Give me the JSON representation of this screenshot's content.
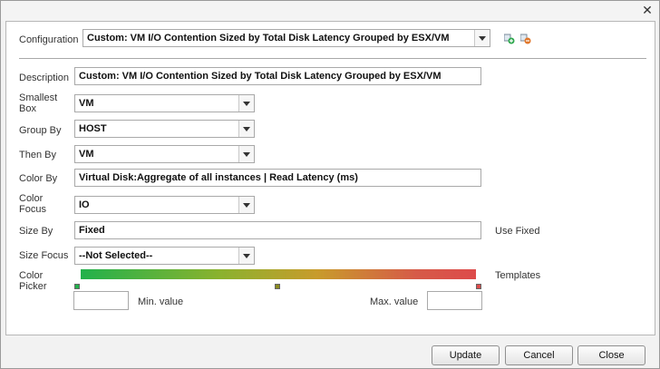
{
  "header": {
    "configuration_label": "Configuration",
    "configuration_value": "Custom: VM I/O Contention Sized by Total Disk Latency Grouped by ESX/VM"
  },
  "form": {
    "description_label": "Description",
    "description_value": "Custom: VM I/O Contention Sized by Total Disk Latency Grouped by ESX/VM",
    "smallest_box_label": "Smallest Box",
    "smallest_box_value": "VM",
    "group_by_label": "Group By",
    "group_by_value": "HOST",
    "then_by_label": "Then By",
    "then_by_value": "VM",
    "color_by_label": "Color By",
    "color_by_value": "Virtual Disk:Aggregate of all instances | Read Latency (ms)",
    "color_focus_label": "Color Focus",
    "color_focus_value": "IO",
    "size_by_label": "Size By",
    "size_by_value": "Fixed",
    "use_fixed_label": "Use Fixed",
    "size_focus_label": "Size Focus",
    "size_focus_value": "--Not Selected--",
    "color_picker_label": "Color Picker",
    "templates_label": "Templates",
    "min_value_label": "Min. value",
    "max_value_label": "Max. value",
    "min_value": "",
    "max_value": ""
  },
  "colors": {
    "gradient_start": "#22b14c",
    "gradient_end": "#dd4b4b"
  },
  "footer": {
    "update_label": "Update",
    "cancel_label": "Cancel",
    "close_label": "Close"
  },
  "icons": [
    "close-icon",
    "add-icon",
    "delete-icon",
    "chevron-down-icon"
  ]
}
